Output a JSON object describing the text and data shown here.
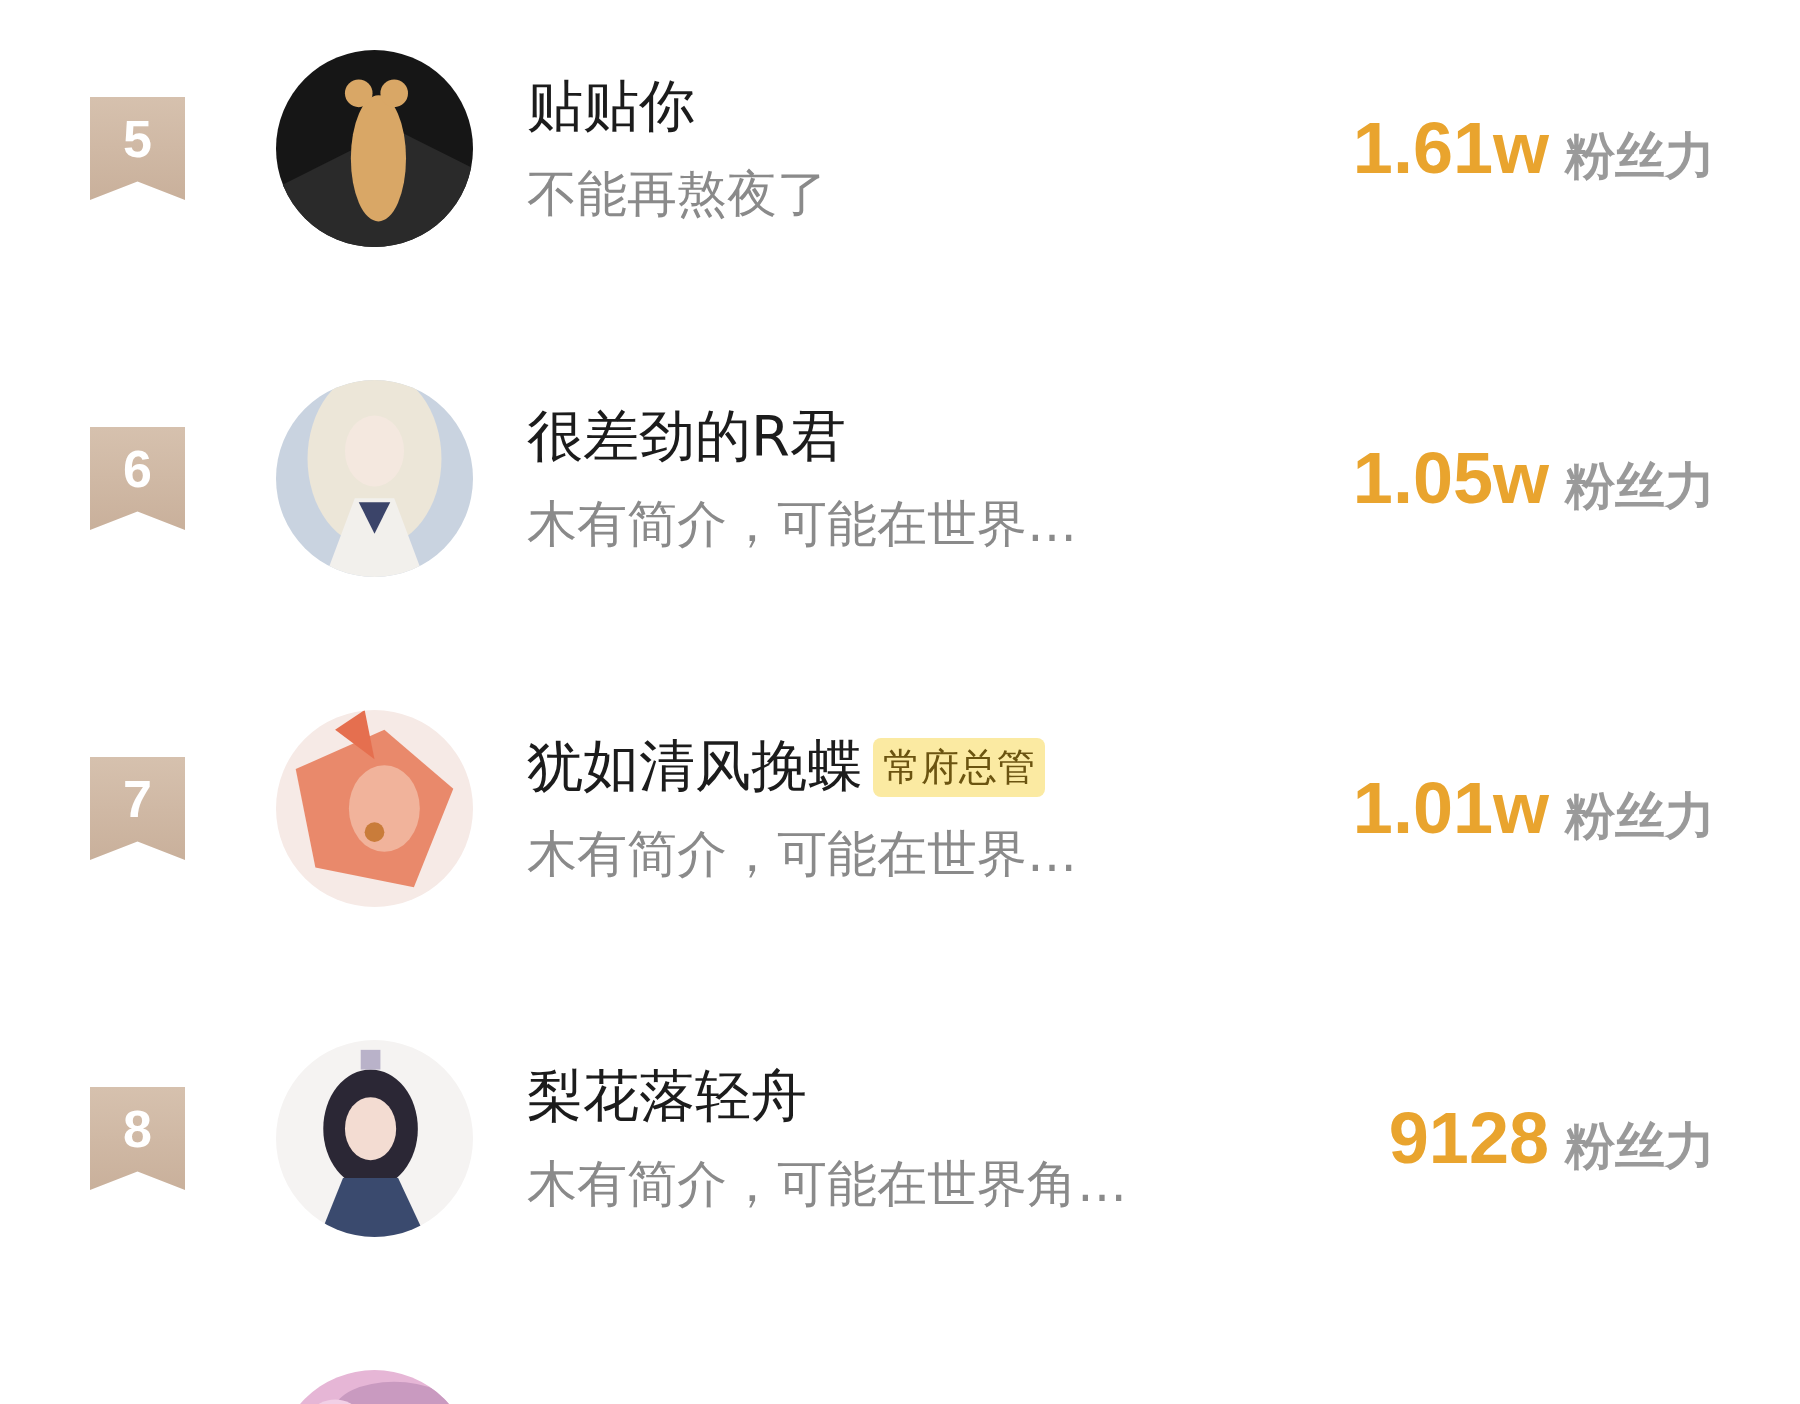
{
  "ranking": [
    {
      "rank": "5",
      "name": "贴贴你",
      "bio": "不能再熬夜了",
      "score": "1.61w",
      "score_label": "粉丝力"
    },
    {
      "rank": "6",
      "name": "很差劲的R君",
      "bio": "木有简介，可能在世界…",
      "score": "1.05w",
      "score_label": "粉丝力"
    },
    {
      "rank": "7",
      "name": "犹如清风挽蝶",
      "tag": "常府总管",
      "bio": "木有简介，可能在世界…",
      "score": "1.01w",
      "score_label": "粉丝力"
    },
    {
      "rank": "8",
      "name": "梨花落轻舟",
      "bio": "木有简介，可能在世界角…",
      "score": "9128",
      "score_label": "粉丝力"
    }
  ]
}
